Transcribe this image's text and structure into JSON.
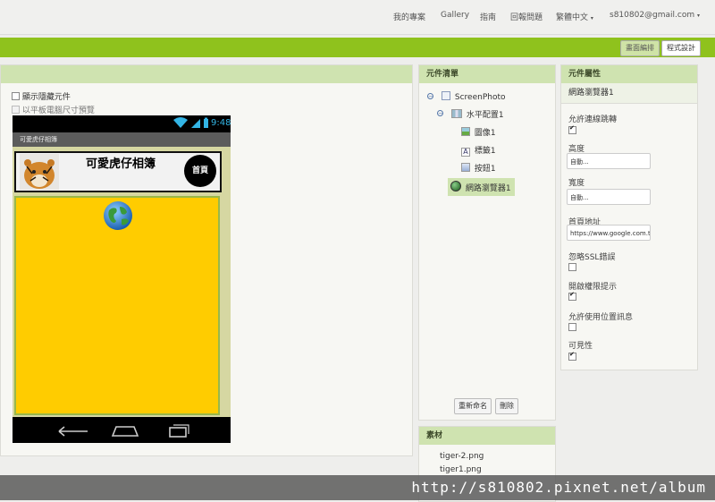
{
  "topnav": {
    "items": [
      "我的專案",
      "Gallery",
      "指南",
      "回報問題",
      "繁體中文",
      "s810802@gmail.com"
    ]
  },
  "toolbar": {
    "designer_label": "畫面編排",
    "blocks_label": "程式設計"
  },
  "viewer": {
    "show_hidden_label": "顯示隱藏元件",
    "tablet_preview_label": "以平板電腦尺寸預覽",
    "phone": {
      "time": "9:48",
      "screen_title": "可愛虎仔相簿",
      "heading": "可愛虎仔相簿",
      "home_button": "首頁"
    }
  },
  "components": {
    "header": "元件清單",
    "tree": [
      {
        "label": "ScreenPhoto",
        "icon": "screen-icon"
      },
      {
        "label": "水平配置1",
        "icon": "horizontal-arrangement-icon"
      },
      {
        "label": "圖像1",
        "icon": "image-icon"
      },
      {
        "label": "標籤1",
        "icon": "label-icon"
      },
      {
        "label": "按鈕1",
        "icon": "button-icon"
      },
      {
        "label": "網路瀏覽器1",
        "icon": "webviewer-icon"
      }
    ],
    "rename_label": "重新命名",
    "delete_label": "刪除"
  },
  "media": {
    "header": "素材",
    "files": [
      "tiger-2.png",
      "tiger1.png"
    ]
  },
  "properties": {
    "header": "元件屬性",
    "component_name": "網路瀏覽器1",
    "allow_navigation_label": "允許連線跳轉",
    "allow_navigation": true,
    "height_label": "高度",
    "height_value": "自動...",
    "width_label": "寬度",
    "width_value": "自動...",
    "home_url_label": "首頁地址",
    "home_url_value": "https://www.google.com.tw",
    "ignore_ssl_label": "忽略SSL錯誤",
    "ignore_ssl": false,
    "prompt_permission_label": "開啟權限提示",
    "prompt_permission": true,
    "use_location_label": "允許使用位置訊息",
    "use_location": false,
    "visible_label": "可見性",
    "visible": true
  },
  "watermark": "http://s810802.pixnet.net/album",
  "colors": {
    "brand_green": "#8fc21d",
    "panel_header": "#cfe3b0",
    "webview_bg": "#ffcc00"
  }
}
